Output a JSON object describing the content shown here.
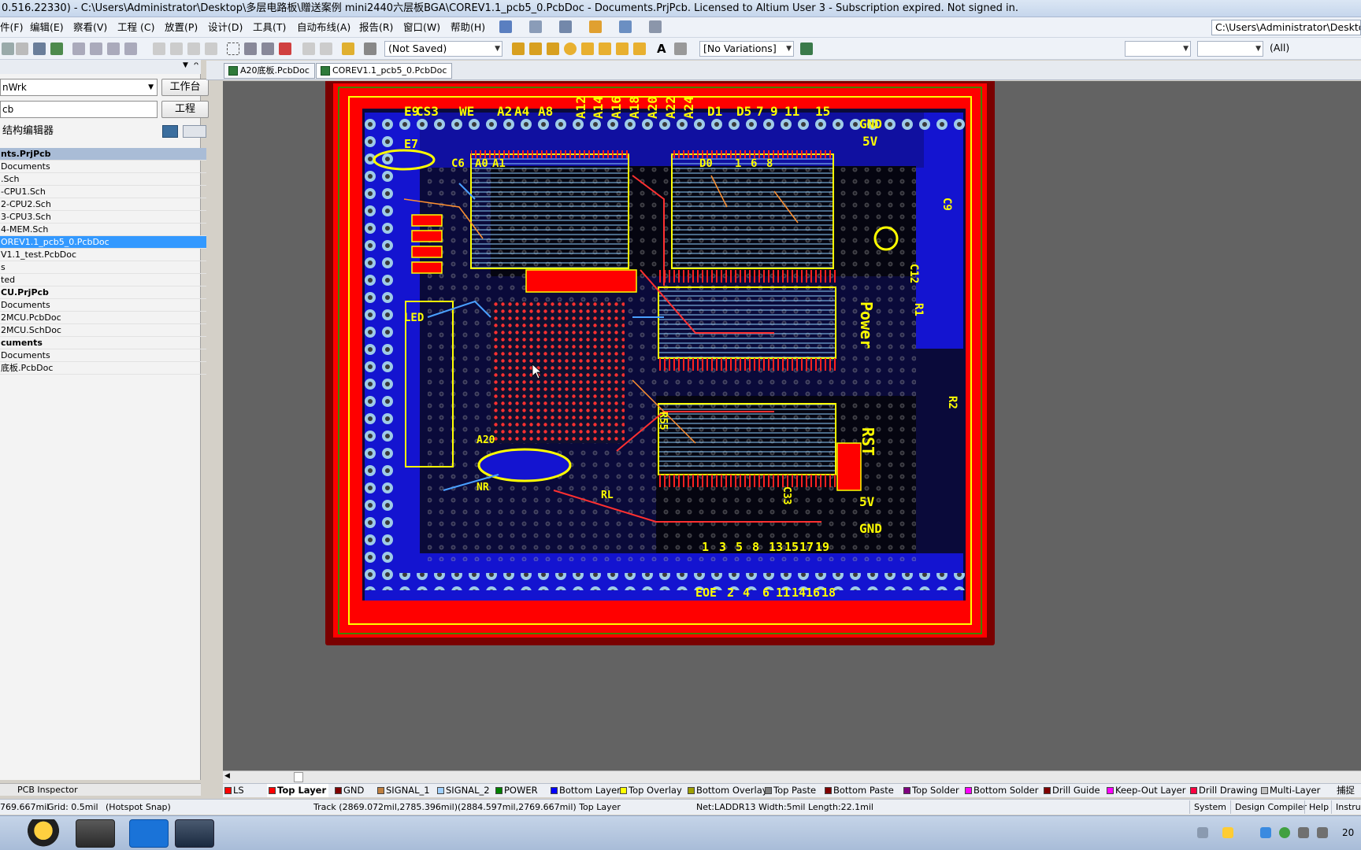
{
  "window": {
    "title": "0.516.22330) - C:\\Users\\Administrator\\Desktop\\多层电路板\\赠送案例 mini2440六层板BGA\\COREV1.1_pcb5_0.PcbDoc - Documents.PrjPcb. Licensed to Altium User 3 - Subscription expired. Not signed in."
  },
  "menubar": {
    "items": [
      "件(F)",
      "编辑(E)",
      "察看(V)",
      "工程 (C)",
      "放置(P)",
      "设计(D)",
      "工具(T)",
      "自动布线(A)",
      "报告(R)",
      "窗口(W)",
      "帮助(H)"
    ],
    "path": "C:\\Users\\Administrator\\Desktop\\"
  },
  "toolbar": {
    "saved_state": "(Not Saved)",
    "variations": "[No Variations]",
    "filter": "(All)"
  },
  "left_panel": {
    "workspace_field": "nWrk",
    "workspace_button": "工作台",
    "project_field": "cb",
    "project_button": "工程",
    "structure_editor": "结构编辑器",
    "tree": [
      {
        "label": "nts.PrjPcb",
        "style": "header"
      },
      {
        "label": "Documents",
        "style": "normal"
      },
      {
        "label": ".Sch",
        "style": "normal"
      },
      {
        "label": "-CPU1.Sch",
        "style": "normal"
      },
      {
        "label": "2-CPU2.Sch",
        "style": "normal"
      },
      {
        "label": "3-CPU3.Sch",
        "style": "normal"
      },
      {
        "label": "4-MEM.Sch",
        "style": "normal"
      },
      {
        "label": "OREV1.1_pcb5_0.PcbDoc",
        "style": "selected"
      },
      {
        "label": "V1.1_test.PcbDoc",
        "style": "normal"
      },
      {
        "label": "s",
        "style": "normal"
      },
      {
        "label": "ted",
        "style": "normal"
      },
      {
        "label": "CU.PrjPcb",
        "style": "bold"
      },
      {
        "label": "Documents",
        "style": "normal"
      },
      {
        "label": "2MCU.PcbDoc",
        "style": "normal"
      },
      {
        "label": "2MCU.SchDoc",
        "style": "normal"
      },
      {
        "label": "cuments",
        "style": "bold"
      },
      {
        "label": "Documents",
        "style": "normal"
      },
      {
        "label": "底板.PcbDoc",
        "style": "normal"
      }
    ],
    "bottom_tab": "PCB Inspector"
  },
  "doc_tabs": [
    "A20底板.PcbDoc",
    "COREV1.1_pcb5_0.PcbDoc"
  ],
  "pcb": {
    "labels_top": [
      "E9",
      "CS3",
      "WE",
      "A2",
      "A4",
      "A8",
      "A12",
      "A14",
      "A16",
      "A18",
      "A20",
      "A22",
      "A24",
      "D1",
      "D5",
      "7",
      "9",
      "11",
      "15"
    ],
    "labels_right": [
      "GND",
      "5V",
      "Power",
      "RST",
      "5V",
      "GND"
    ],
    "labels_bottom_a": [
      "1",
      "3",
      "5",
      "8",
      "13",
      "15",
      "17",
      "19"
    ],
    "labels_bottom_b": [
      "EOE",
      "2",
      "4",
      "6",
      "11",
      "14",
      "16",
      "18"
    ],
    "labels_misc": [
      "C6",
      "A0",
      "A1",
      "D0",
      "1",
      "6",
      "8",
      "LED",
      "C12",
      "C9",
      "R1",
      "R2",
      "R55",
      "A20",
      "NR",
      "C33",
      "RL",
      "E7"
    ]
  },
  "layers": [
    {
      "name": "LS",
      "color": "#ff0000"
    },
    {
      "name": "Top Layer",
      "color": "#ff0000",
      "active": true
    },
    {
      "name": "GND",
      "color": "#800000"
    },
    {
      "name": "SIGNAL_1",
      "color": "#c08040"
    },
    {
      "name": "SIGNAL_2",
      "color": "#a0d0ff"
    },
    {
      "name": "POWER",
      "color": "#008000"
    },
    {
      "name": "Bottom Layer",
      "color": "#0000ff"
    },
    {
      "name": "Top Overlay",
      "color": "#ffff00"
    },
    {
      "name": "Bottom Overlay",
      "color": "#a0a000"
    },
    {
      "name": "Top Paste",
      "color": "#808080"
    },
    {
      "name": "Bottom Paste",
      "color": "#800000"
    },
    {
      "name": "Top Solder",
      "color": "#800080"
    },
    {
      "name": "Bottom Solder",
      "color": "#ff00ff"
    },
    {
      "name": "Drill Guide",
      "color": "#800000"
    },
    {
      "name": "Keep-Out Layer",
      "color": "#ff00ff"
    },
    {
      "name": "Drill Drawing",
      "color": "#ff0040"
    },
    {
      "name": "Multi-Layer",
      "color": "#c0c0c0"
    }
  ],
  "layer_bar_extra": "捕捉",
  "statusbar": {
    "coords": "769.667mil",
    "grid": "Grid: 0.5mil",
    "snap": "(Hotspot Snap)",
    "track": "Track (2869.072mil,2785.396mil)(2884.597mil,2769.667mil)  Top Layer",
    "net": "Net:LADDR13 Width:5mil Length:22.1mil",
    "buttons": [
      "System",
      "Design Compiler",
      "Help",
      "Instrum"
    ]
  },
  "taskbar": {
    "clock": "20"
  }
}
